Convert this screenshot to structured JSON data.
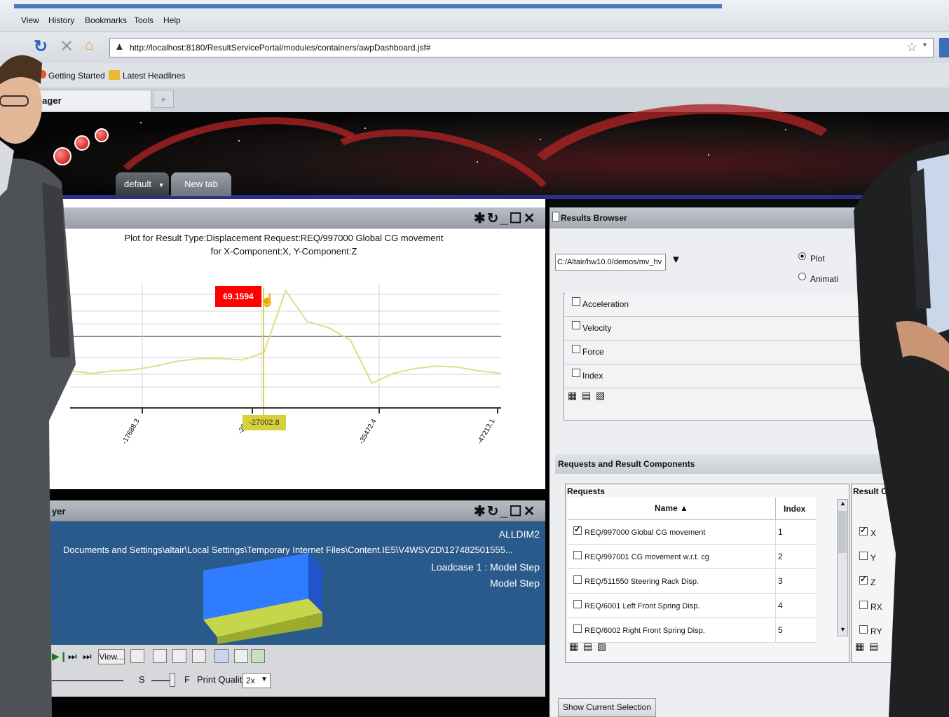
{
  "browser": {
    "menu": [
      "View",
      "History",
      "Bookmarks",
      "Tools",
      "Help"
    ],
    "url": "http://localhost:8180/ResultServicePortal/modules/containers/awpDashboard.jsf#",
    "bookmarks": [
      "Getting Started",
      "Latest Headlines"
    ],
    "tab_title": "anager",
    "new_tab_symbol": "+"
  },
  "dashboard": {
    "tabs": [
      "default",
      "New tab"
    ],
    "tab_dropdown": "▼"
  },
  "plot": {
    "controls": "✱↻_☐✕",
    "title_line1": "Plot for Result Type:Displacement Request:REQ/997000 Global CG movement",
    "title_line2": "for  X-Component:X, Y-Component:Z",
    "tooltip_value": "69.1594",
    "cursor_x_label": "-27002.8"
  },
  "chart_data": {
    "type": "line",
    "x_ticks": [
      "-17688.3",
      "-26...",
      "-35472.4",
      "-47213.1"
    ],
    "marker": {
      "x": "-27002.8",
      "y": "69.1594"
    },
    "series": [
      {
        "values": [
          0.3,
          0.28,
          0.3,
          0.31,
          0.34,
          0.38,
          0.4,
          0.4,
          0.39,
          0.45,
          0.95,
          0.7,
          0.65,
          0.55,
          0.2,
          0.28,
          0.32,
          0.34,
          0.33,
          0.3,
          0.28
        ]
      }
    ],
    "color": "#e0dd86"
  },
  "viewer": {
    "title": "yer",
    "controls": "✱↻_☐✕",
    "model": "ALLDIM2",
    "path": "Documents and Settings\\altair\\Local Settings\\Temporary Internet Files\\Content.IE5\\V4WSV2D\\127482501555...",
    "loadcase": "Loadcase 1 : Model Step",
    "step": "Model Step",
    "view_button": "View...",
    "s_label": "S",
    "f_label": "F",
    "print_quality_label": "Print Quality",
    "print_quality_value": "2x"
  },
  "results_browser": {
    "title": "Results Browser",
    "path": "C:/Altair/hw10.0/demos/mv_hv",
    "radio_plot": "Plot",
    "radio_anim": "Animati",
    "types": [
      "Acceleration",
      "Velocity",
      "Force",
      "Index"
    ],
    "section_title": "Requests and Result Components",
    "requests_header": "Requests",
    "col_name": "Name ▲",
    "col_index": "Index",
    "rows": [
      {
        "name": "REQ/997000 Global CG movement",
        "index": "1",
        "checked": true
      },
      {
        "name": "REQ/997001 CG movement w.r.t. cg",
        "index": "2",
        "checked": false
      },
      {
        "name": "REQ/511550 Steering Rack Disp.",
        "index": "3",
        "checked": false
      },
      {
        "name": "REQ/6001 Left Front Spring Disp.",
        "index": "4",
        "checked": false
      },
      {
        "name": "REQ/6002 Right Front Spring Disp.",
        "index": "5",
        "checked": false
      }
    ],
    "components_header": "Result Comp",
    "components": [
      {
        "name": "X",
        "checked": true
      },
      {
        "name": "Y",
        "checked": false
      },
      {
        "name": "Z",
        "checked": true
      },
      {
        "name": "RX",
        "checked": false
      },
      {
        "name": "RY",
        "checked": false
      }
    ],
    "show_button": "Show Current Selection"
  }
}
